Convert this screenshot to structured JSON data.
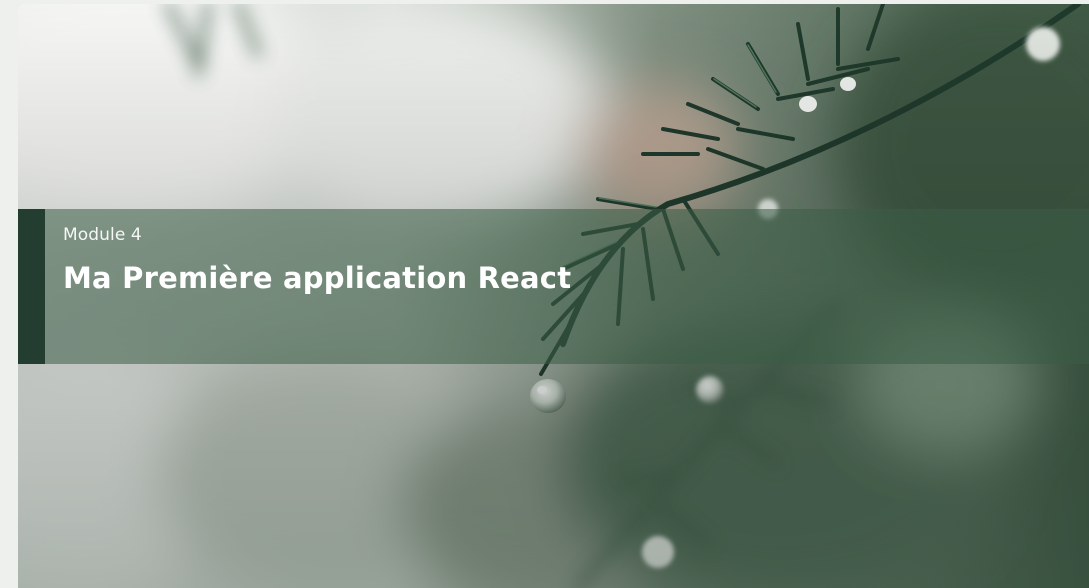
{
  "module": {
    "label": "Module 4",
    "title": "Ma Première application React"
  },
  "hero": {
    "image_subject": "fir-branch-with-raindrops",
    "palette": {
      "band_overlay": "#3a5c46",
      "accent_bar": "#243d31",
      "foliage_dark": "#1f3a2c",
      "foliage_mid": "#476a52",
      "bokeh_light": "#f2f3f1",
      "page_background": "#eef0ee"
    }
  }
}
